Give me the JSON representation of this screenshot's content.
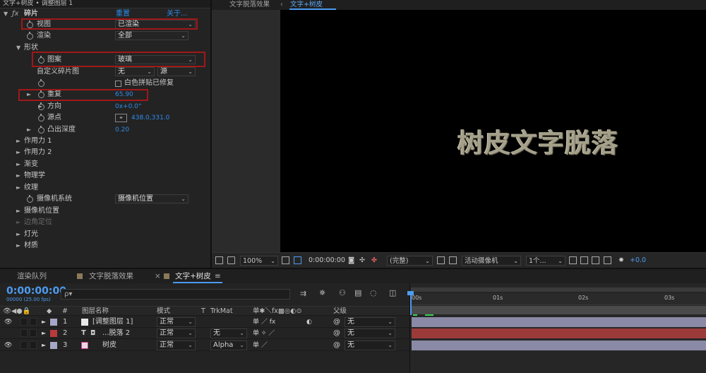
{
  "effect_controls": {
    "panel_title": "文字+树皮 • 调整图层 1",
    "effect_name": "碎片",
    "reset": "重置",
    "about": "关于...",
    "rows": {
      "view": {
        "label": "视图",
        "value": "已渲染"
      },
      "render": {
        "label": "渲染",
        "value": "全部"
      },
      "shape": {
        "label": "形状"
      },
      "pattern": {
        "label": "图案",
        "value": "玻璃"
      },
      "custom_shatter": {
        "label": "自定义碎片图",
        "value": "无",
        "value2": "源"
      },
      "white_tiles": {
        "label": "白色拼贴已修复"
      },
      "repetitions": {
        "label": "重复",
        "value": "65.90"
      },
      "direction": {
        "label": "方向",
        "value": "0x+0.0°"
      },
      "origin": {
        "label": "源点",
        "value": "438.0,331.0"
      },
      "extrusion_depth": {
        "label": "凸出深度",
        "value": "0.20"
      },
      "force1": {
        "label": "作用力 1"
      },
      "force2": {
        "label": "作用力 2"
      },
      "gradient": {
        "label": "渐变"
      },
      "physics": {
        "label": "物理学"
      },
      "textures": {
        "label": "纹理"
      },
      "camera_system": {
        "label": "摄像机系统",
        "value": "摄像机位置"
      },
      "camera_position": {
        "label": "摄像机位置"
      },
      "corner_pins": {
        "label": "边角定位"
      },
      "lighting": {
        "label": "灯光"
      },
      "material": {
        "label": "材质"
      }
    }
  },
  "viewer": {
    "tabs": [
      "文字脱落效果",
      "文字+树皮"
    ],
    "canvas_text": "树皮文字脱落",
    "zoom": "100%",
    "timecode": "0:00:00:00",
    "resolution": "(完整)",
    "camera": "活动摄像机",
    "views": "1个...",
    "exposure": "+0.0"
  },
  "timeline": {
    "tabs": [
      "渲染队列",
      "文字脱落效果",
      "文字+树皮"
    ],
    "timecode": "0:00:00:00",
    "timecode_sub": "00000 (25.00 fps)",
    "search_placeholder": "ρ▾",
    "headers": {
      "num": "#",
      "layer_name": "图层名称",
      "mode": "模式",
      "t": "T",
      "trkmat": "TrkMat",
      "parent": "父级"
    },
    "layers": [
      {
        "num": "1",
        "name": "[调整图层 1]",
        "mode": "正常",
        "trkmat": "",
        "parent": "无",
        "color": "#e8e8e8",
        "label_color": "#a6a6c8"
      },
      {
        "num": "2",
        "name": "...脱落 2",
        "mode": "正常",
        "trkmat": "无",
        "parent": "无",
        "color": "#b83a3a",
        "label_color": "#b83a3a"
      },
      {
        "num": "3",
        "name": "树皮",
        "mode": "正常",
        "trkmat": "Alpha",
        "parent": "无",
        "color": "#a6a6c8",
        "label_color": "#a6a6c8"
      }
    ],
    "ruler_ticks": [
      "00s",
      "01s",
      "02s",
      "03s"
    ]
  },
  "colors": {
    "accent_blue": "#4d9cf0",
    "highlight_red": "#a01818"
  }
}
